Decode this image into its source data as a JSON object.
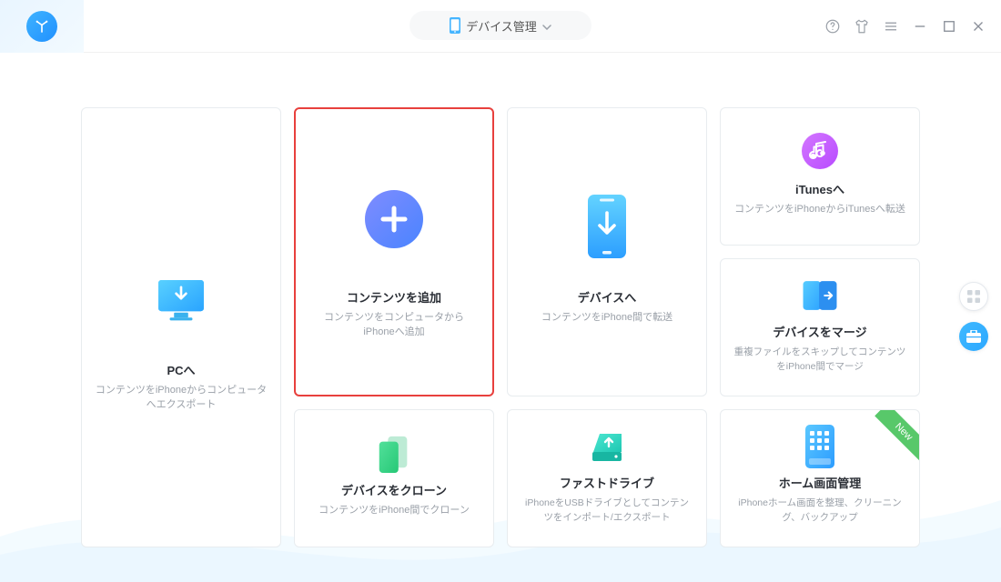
{
  "header": {
    "dropdown_label": "デバイス管理"
  },
  "cards": {
    "pc": {
      "title": "PCへ",
      "desc": "コンテンツをiPhoneからコンピュータへエクスポート"
    },
    "add": {
      "title": "コンテンツを追加",
      "desc": "コンテンツをコンピュータからiPhoneへ追加"
    },
    "device": {
      "title": "デバイスへ",
      "desc": "コンテンツをiPhone間で転送"
    },
    "itunes": {
      "title": "iTunesへ",
      "desc": "コンテンツをiPhoneからiTunesへ転送"
    },
    "merge": {
      "title": "デバイスをマージ",
      "desc": "重複ファイルをスキップしてコンテンツをiPhone間でマージ"
    },
    "clone": {
      "title": "デバイスをクローン",
      "desc": "コンテンツをiPhone間でクローン"
    },
    "fast": {
      "title": "ファストドライブ",
      "desc": "iPhoneをUSBドライブとしてコンテンツをインポート/エクスポート"
    },
    "home": {
      "title": "ホーム画面管理",
      "desc": "iPhoneホーム画面を整理、クリーニング、バックアップ",
      "ribbon": "New"
    }
  },
  "colors": {
    "highlight_border": "#e8403d",
    "accent_blue": "#3fb3ff",
    "accent_purple": "#b46dff",
    "accent_green": "#3dd27b",
    "accent_teal": "#2dd5c4"
  }
}
